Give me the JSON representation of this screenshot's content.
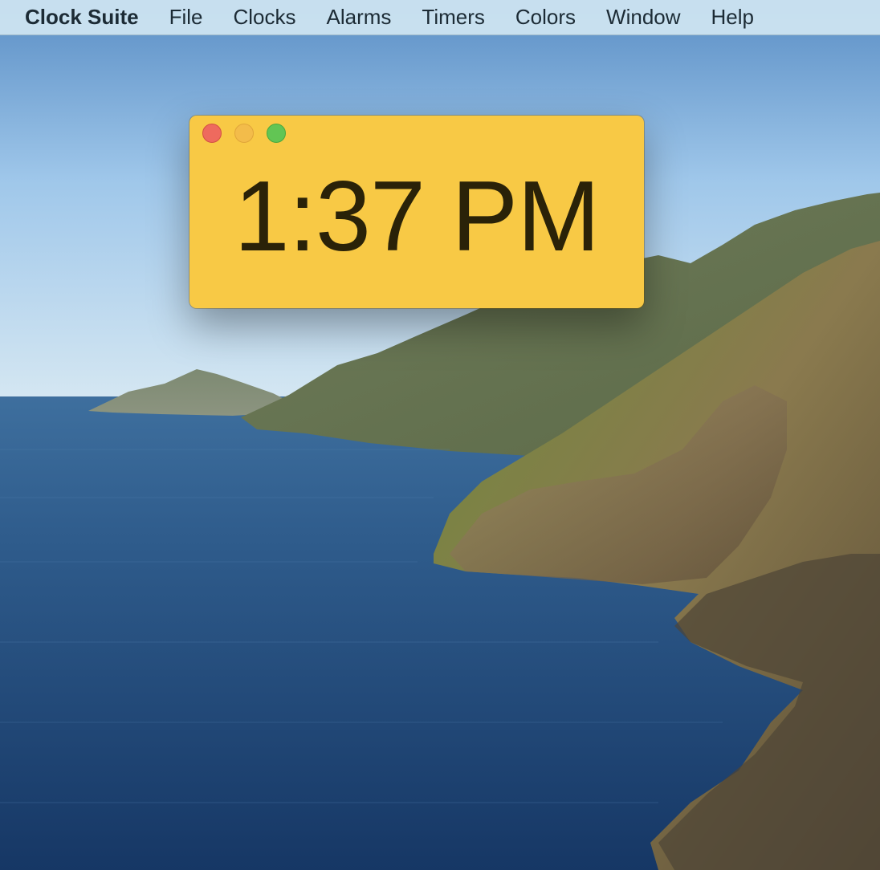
{
  "menubar": {
    "app_name": "Clock Suite",
    "items": [
      {
        "label": "File"
      },
      {
        "label": "Clocks"
      },
      {
        "label": "Alarms"
      },
      {
        "label": "Timers"
      },
      {
        "label": "Colors"
      },
      {
        "label": "Window"
      },
      {
        "label": "Help"
      }
    ]
  },
  "clock_window": {
    "time": "1:37 PM",
    "background_color": "#f8c945",
    "buttons": {
      "close_icon": "close-icon",
      "minimize_icon": "minimize-icon",
      "zoom_icon": "zoom-icon"
    }
  },
  "desktop": {
    "wallpaper": "coastal cliffs and ocean"
  }
}
